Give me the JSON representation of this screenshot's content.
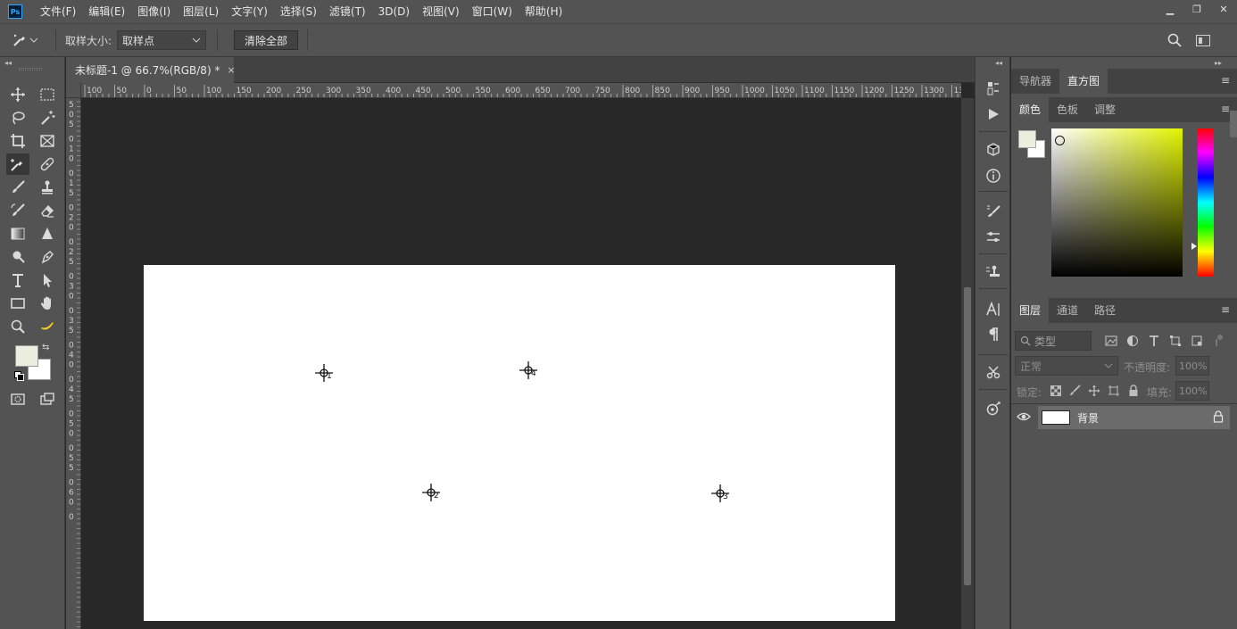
{
  "app": {
    "logo": "Ps"
  },
  "menu": [
    "文件(F)",
    "编辑(E)",
    "图像(I)",
    "图层(L)",
    "文字(Y)",
    "选择(S)",
    "滤镜(T)",
    "3D(D)",
    "视图(V)",
    "窗口(W)",
    "帮助(H)"
  ],
  "window_controls": {
    "minimize": "▁",
    "restore": "❐",
    "close": "✕"
  },
  "options": {
    "sample_size_label": "取样大小:",
    "sample_size_value": "取样点",
    "clear_all": "清除全部"
  },
  "document": {
    "tab_title": "未标题-1 @ 66.7%(RGB/8) *",
    "close": "×"
  },
  "ruler_h_labels": [
    "100",
    "50",
    "0",
    "50",
    "100",
    "150",
    "200",
    "250",
    "300",
    "350",
    "400",
    "450",
    "500",
    "550",
    "600",
    "650",
    "700",
    "750",
    "800",
    "850",
    "900",
    "950",
    "1000",
    "1050",
    "1100",
    "1150",
    "1200",
    "1250",
    "1300",
    "13"
  ],
  "ruler_v_labels": [
    "5",
    "0",
    "5",
    "0",
    "1",
    "0",
    "0",
    "1",
    "5",
    "0",
    "2",
    "0",
    "0",
    "2",
    "5",
    "0",
    "3",
    "0",
    "0",
    "3",
    "5",
    "0",
    "4",
    "0",
    "0",
    "4",
    "5",
    "0",
    "5",
    "0",
    "0",
    "5",
    "5",
    "0",
    "6",
    "0",
    "0"
  ],
  "color_samplers": [
    "1",
    "2",
    "3",
    "4"
  ],
  "panels": {
    "top_tabs": [
      "导航器",
      "直方图"
    ],
    "color_tabs": [
      "颜色",
      "色板",
      "调整"
    ],
    "layers_tabs": [
      "图层",
      "通道",
      "路径"
    ],
    "menu_icon": "≡"
  },
  "colors": {
    "foreground": "#ecefe0",
    "background": "#ffffff",
    "picker_hue": "#e2f400"
  },
  "layers": {
    "search_placeholder": "类型",
    "blend_mode": "正常",
    "opacity_label": "不透明度:",
    "opacity_value": "100%",
    "lock_label": "锁定:",
    "fill_label": "填充:",
    "fill_value": "100%",
    "items": [
      {
        "name": "背景"
      }
    ]
  }
}
